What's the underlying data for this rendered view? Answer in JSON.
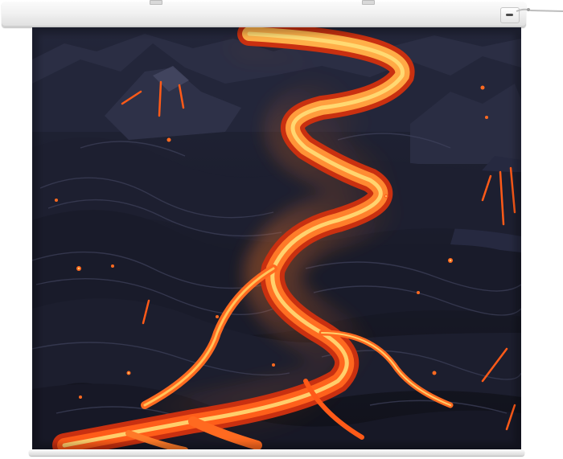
{
  "image": {
    "subject": "projector-screen-with-lava-landscape",
    "colors": {
      "housing": "#efefef",
      "bottom_bar": "#ececec",
      "rock_dark": "#141622",
      "rock_mid": "#2a2c3f",
      "rock_light": "#4a4d68",
      "lava_hot": "#ffe27a",
      "lava_mid": "#ff7a28",
      "lava_deep": "#c93010"
    }
  }
}
